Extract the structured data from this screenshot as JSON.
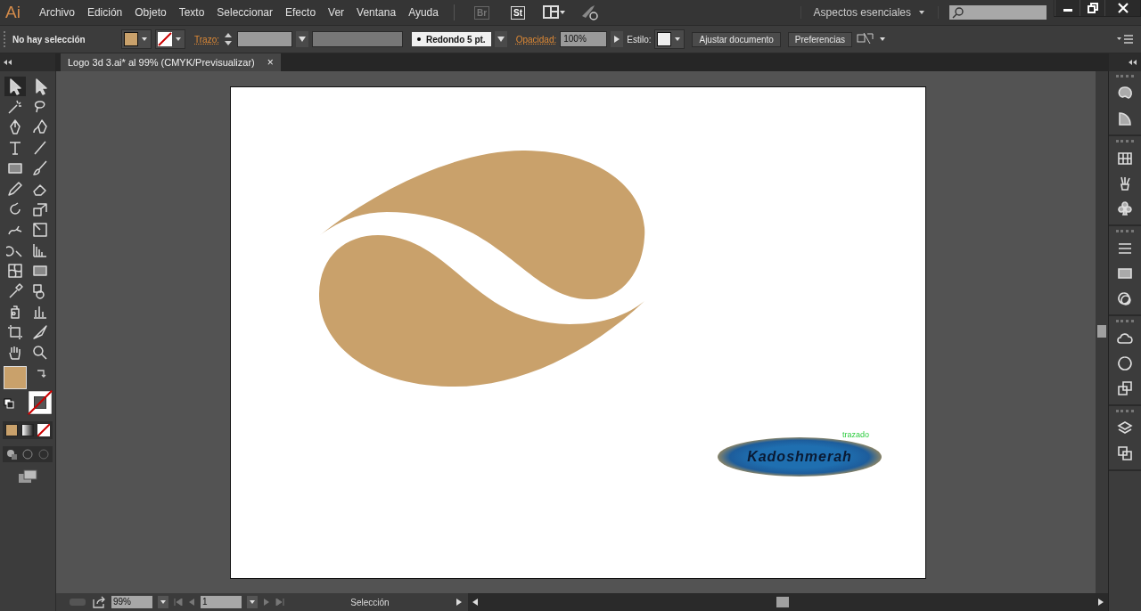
{
  "app_logo": "Ai",
  "menu": [
    "Archivo",
    "Edición",
    "Objeto",
    "Texto",
    "Seleccionar",
    "Efecto",
    "Ver",
    "Ventana",
    "Ayuda"
  ],
  "app_buttons": [
    "Br",
    "St"
  ],
  "workspace": "Aspectos esenciales",
  "control_bar": {
    "selection_status": "No hay selección",
    "stroke_label": "Trazo:",
    "brush": "Redondo 5 pt.",
    "opacity_label": "Opacidad:",
    "opacity": "100%",
    "style_label": "Estilo:",
    "buttons": [
      "Ajustar documento",
      "Preferencias"
    ]
  },
  "document_tab": {
    "title": "Logo 3d 3.ai* al 99% (CMYK/Previsualizar)",
    "close": "×"
  },
  "tools": [
    {
      "selected": true
    },
    {
      "selected": false
    },
    {
      "selected": false
    },
    {
      "selected": false
    },
    {
      "selected": false
    },
    {
      "selected": false
    },
    {
      "selected": false
    },
    {
      "selected": false
    },
    {
      "selected": false
    },
    {
      "selected": false
    },
    {
      "selected": false
    },
    {
      "selected": false
    },
    {
      "selected": false
    },
    {
      "selected": false
    },
    {
      "selected": false
    },
    {
      "selected": false
    },
    {
      "selected": false
    },
    {
      "selected": false
    },
    {
      "selected": false
    },
    {
      "selected": false
    },
    {
      "selected": false
    },
    {
      "selected": false
    },
    {
      "selected": false
    },
    {
      "selected": false
    },
    {
      "selected": false
    },
    {
      "selected": false
    },
    {
      "selected": false
    },
    {
      "selected": false
    }
  ],
  "artwork": {
    "badge_text": "Kadoshmerah",
    "smart_guide": "trazado"
  },
  "status_bar": {
    "zoom": "99%",
    "artboard": "1",
    "tool": "Selección"
  }
}
